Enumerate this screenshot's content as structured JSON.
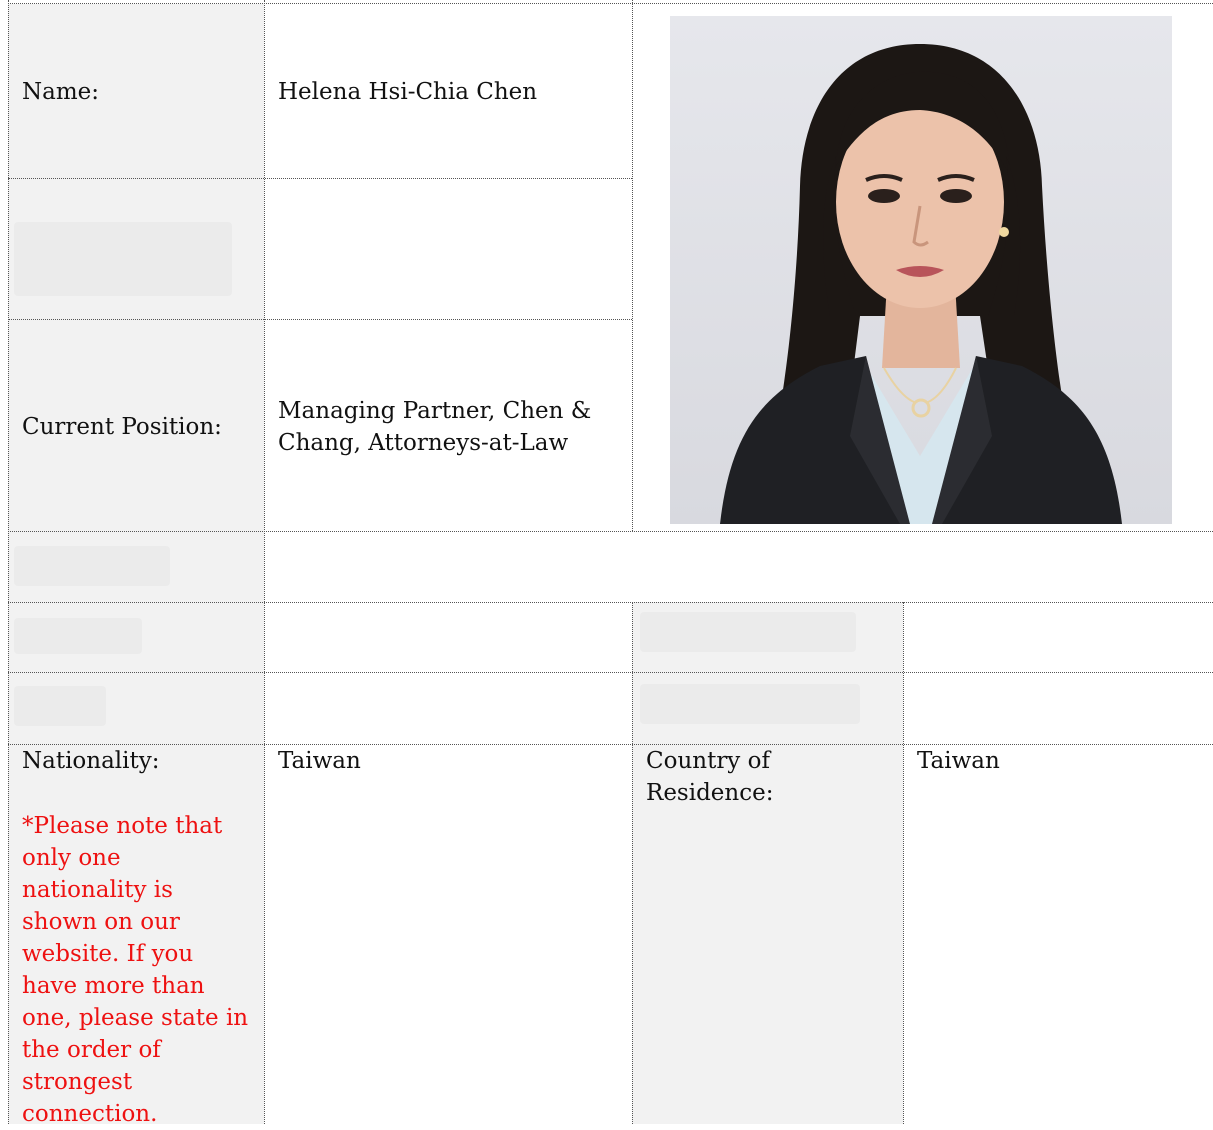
{
  "form": {
    "name_label": "Name:",
    "name_value": "Helena Hsi-Chia Chen",
    "position_label": "Current Position:",
    "position_value": "Managing Partner, Chen &\nChang, Attorneys-at-Law",
    "nationality_label": "Nationality:",
    "nationality_note": "*Please note that\nonly one\nnationality is\nshown on our\nwebsite. If you\nhave more than\none, please state in\nthe order of\nstrongest\nconnection.",
    "nationality_value": "Taiwan",
    "residence_label": "Country of\nResidence:",
    "residence_value": "Taiwan"
  },
  "photo": {
    "icon": "portrait-photo",
    "colors": {
      "background": "#dfe0e6",
      "hair": "#1c1714",
      "skin": "#ecc2aa",
      "jacket": "#1f2024",
      "blouse": "#d6e6ee",
      "note_red": "#ee1111",
      "label_shade": "#f2f2f2"
    }
  }
}
